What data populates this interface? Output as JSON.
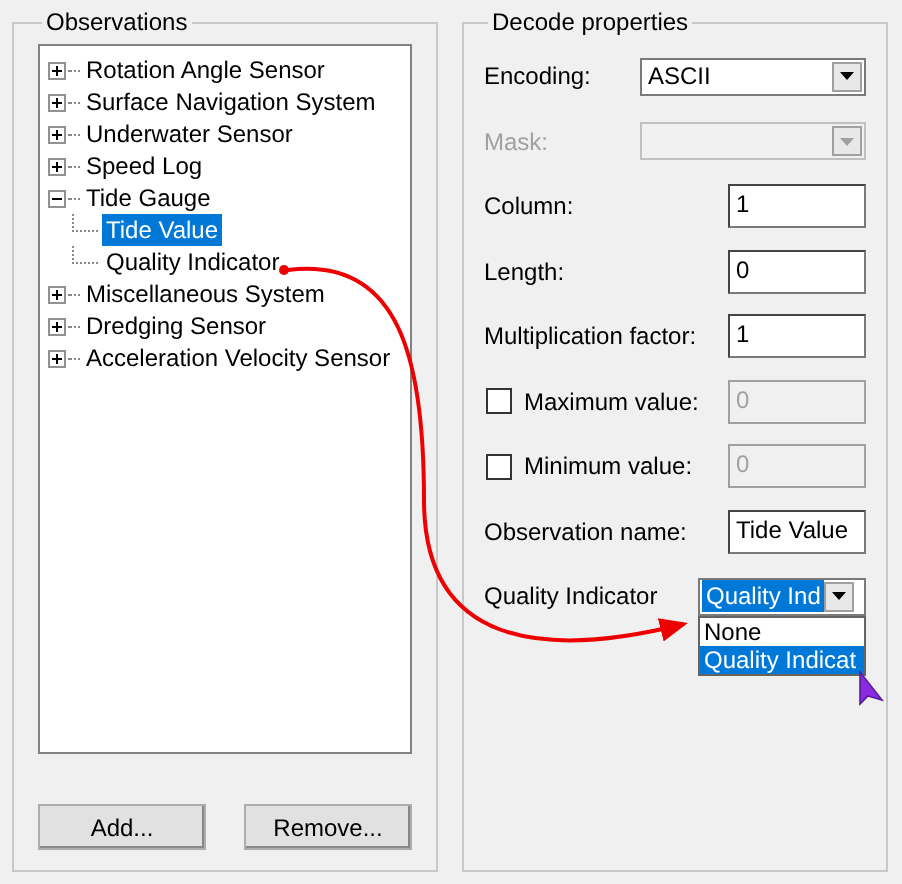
{
  "observations": {
    "title": "Observations",
    "tree": [
      {
        "label": "Rotation Angle Sensor",
        "expanded": false,
        "selected": false
      },
      {
        "label": "Surface Navigation System",
        "expanded": false,
        "selected": false
      },
      {
        "label": "Underwater Sensor",
        "expanded": false,
        "selected": false
      },
      {
        "label": "Speed Log",
        "expanded": false,
        "selected": false
      },
      {
        "label": "Tide Gauge",
        "expanded": true,
        "selected": false,
        "children": [
          {
            "label": "Tide Value",
            "selected": true
          },
          {
            "label": "Quality Indicator",
            "selected": false
          }
        ]
      },
      {
        "label": "Miscellaneous System",
        "expanded": false,
        "selected": false
      },
      {
        "label": "Dredging Sensor",
        "expanded": false,
        "selected": false
      },
      {
        "label": "Acceleration Velocity Sensor",
        "expanded": false,
        "selected": false
      }
    ],
    "buttons": [
      "Add...",
      "Remove..."
    ]
  },
  "decode": {
    "title": "Decode properties",
    "fields": [
      {
        "kind": "combo",
        "label": "Encoding:",
        "value": "ASCII",
        "disabled": false
      },
      {
        "kind": "combo",
        "label": "Mask:",
        "disabled": true
      },
      {
        "kind": "text",
        "label": "Column:",
        "value": "1"
      },
      {
        "kind": "text",
        "label": "Length:",
        "value": "0"
      },
      {
        "kind": "text",
        "label": "Multiplication factor:",
        "value": "1"
      },
      {
        "kind": "check",
        "label": "Maximum value:",
        "checked": false,
        "value": "0"
      },
      {
        "kind": "check",
        "label": "Minimum value:",
        "checked": false,
        "value": "0"
      },
      {
        "kind": "text",
        "label": "Observation name:",
        "value": "Tide Value"
      },
      {
        "kind": "dropdown",
        "label": "Quality Indicator",
        "value": "Quality Ind",
        "options": [
          {
            "label": "None",
            "selected": false
          },
          {
            "label": "Quality Indicat",
            "selected": true
          }
        ]
      }
    ]
  }
}
